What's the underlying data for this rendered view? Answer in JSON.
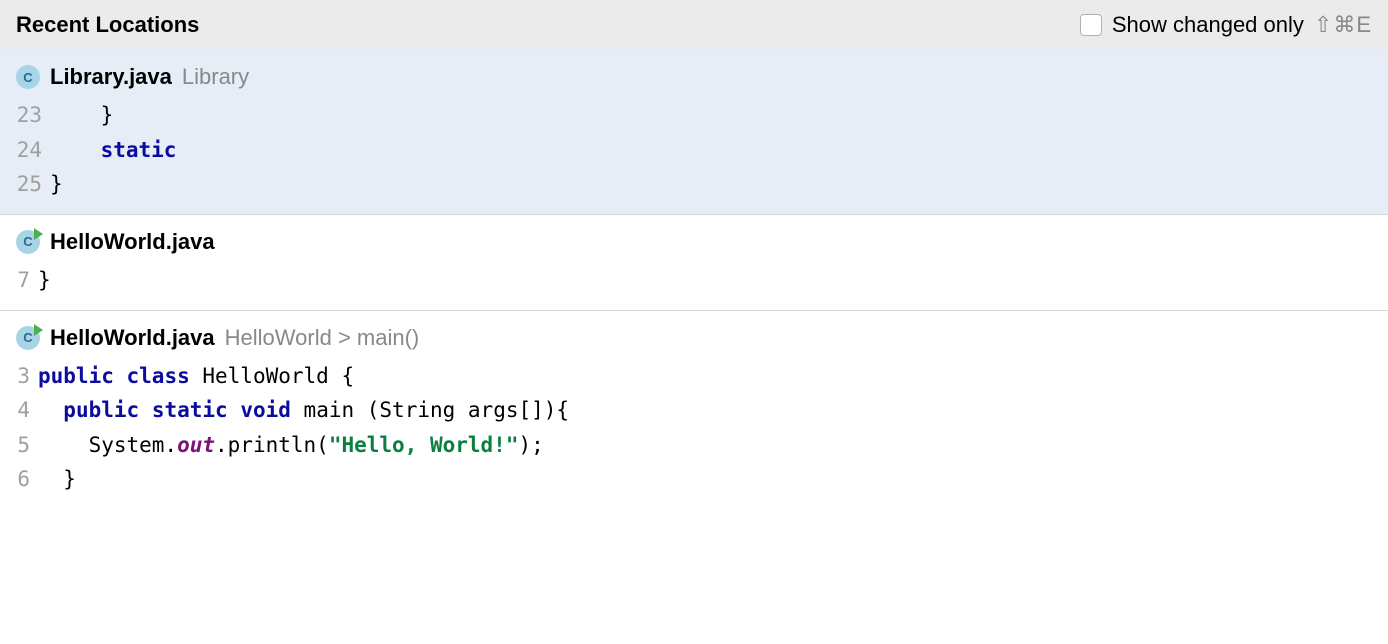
{
  "header": {
    "title": "Recent Locations",
    "checkbox_label": "Show changed only",
    "shortcut": "⇧⌘E"
  },
  "locations": [
    {
      "file_name": "Library.java",
      "breadcrumb": "Library",
      "icon_letter": "C",
      "has_run_badge": false,
      "selected": true,
      "lines": [
        {
          "num": "23",
          "tokens": [
            {
              "t": "plain",
              "v": "    }"
            }
          ]
        },
        {
          "num": "24",
          "tokens": [
            {
              "t": "plain",
              "v": "    "
            },
            {
              "t": "kw",
              "v": "static"
            }
          ]
        },
        {
          "num": "25",
          "tokens": [
            {
              "t": "plain",
              "v": "}"
            }
          ]
        }
      ]
    },
    {
      "file_name": "HelloWorld.java",
      "breadcrumb": "",
      "icon_letter": "C",
      "has_run_badge": true,
      "selected": false,
      "lines": [
        {
          "num": "7",
          "tokens": [
            {
              "t": "plain",
              "v": "}"
            }
          ]
        }
      ]
    },
    {
      "file_name": "HelloWorld.java",
      "breadcrumb": "HelloWorld > main()",
      "icon_letter": "C",
      "has_run_badge": true,
      "selected": false,
      "lines": [
        {
          "num": "3",
          "tokens": [
            {
              "t": "kw",
              "v": "public"
            },
            {
              "t": "plain",
              "v": " "
            },
            {
              "t": "kw",
              "v": "class"
            },
            {
              "t": "plain",
              "v": " HelloWorld {"
            }
          ]
        },
        {
          "num": "4",
          "tokens": [
            {
              "t": "plain",
              "v": "  "
            },
            {
              "t": "kw",
              "v": "public"
            },
            {
              "t": "plain",
              "v": " "
            },
            {
              "t": "kw",
              "v": "static"
            },
            {
              "t": "plain",
              "v": " "
            },
            {
              "t": "kw",
              "v": "void"
            },
            {
              "t": "plain",
              "v": " main (String args[]){"
            }
          ]
        },
        {
          "num": "5",
          "tokens": [
            {
              "t": "plain",
              "v": "    System."
            },
            {
              "t": "field",
              "v": "out"
            },
            {
              "t": "plain",
              "v": ".println("
            },
            {
              "t": "str",
              "v": "\"Hello, World!\""
            },
            {
              "t": "plain",
              "v": ");"
            }
          ]
        },
        {
          "num": "6",
          "tokens": [
            {
              "t": "plain",
              "v": "  }"
            }
          ]
        }
      ]
    }
  ]
}
